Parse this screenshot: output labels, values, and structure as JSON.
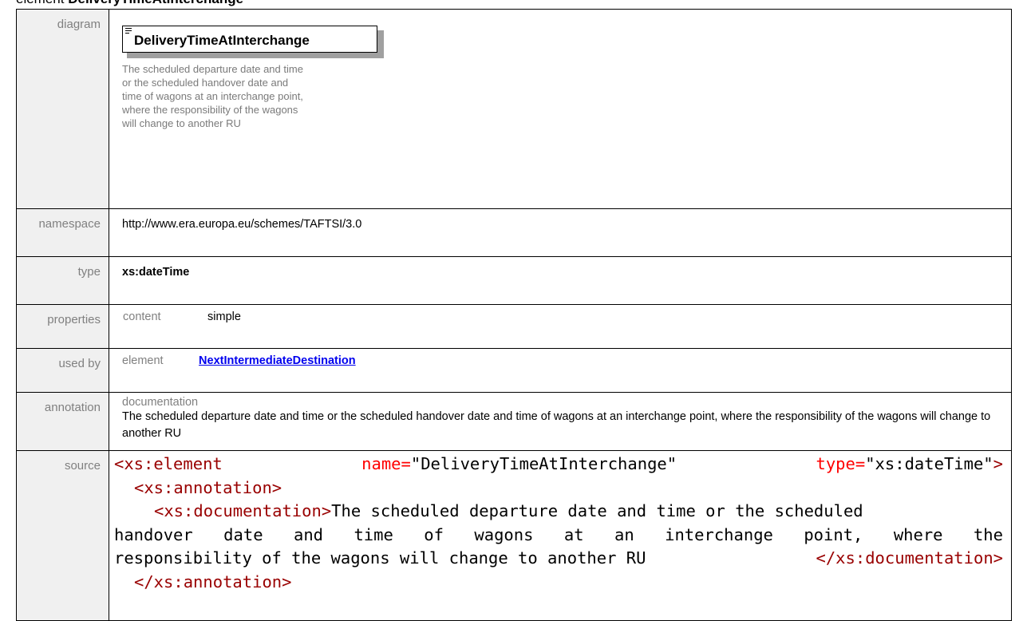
{
  "heading": {
    "prefix": "element",
    "name": "DeliveryTimeAtInterchange"
  },
  "rows": {
    "diagram": {
      "label": "diagram",
      "box_title": "DeliveryTimeAtInterchange",
      "doc": "The scheduled departure date and time or the scheduled handover date and time of wagons at an interchange point, where the responsibility of the wagons will change to another RU"
    },
    "namespace": {
      "label": "namespace",
      "value": "http://www.era.europa.eu/schemes/TAFTSI/3.0"
    },
    "type": {
      "label": "type",
      "value": "xs:dateTime"
    },
    "properties": {
      "label": "properties",
      "key": "content",
      "value": "simple"
    },
    "used_by": {
      "label": "used by",
      "key": "element",
      "link": "NextIntermediateDestination"
    },
    "annotation": {
      "label": "annotation",
      "head": "documentation",
      "text": "The scheduled departure date and time or the scheduled handover date and time of wagons at an interchange point, where the responsibility of the wagons will change to another RU"
    },
    "source": {
      "label": "source",
      "l1_tag": "<xs:element",
      "l1_attr1": "name=",
      "l1_val1": "\"DeliveryTimeAtInterchange\"",
      "l1_attr2": "type=",
      "l1_val2": "\"xs:dateTime\"",
      "l1_close": ">",
      "l2_tag": "<xs:annotation>",
      "l3_tag": "<xs:documentation>",
      "l3_text": "The scheduled departure date and time or the scheduled",
      "l4_text": "handover date and time of wagons at an interchange point, where the",
      "l5_text": "responsibility of the wagons will change to another RU",
      "l5_tag": "</xs:documentation>",
      "l6_tag": "</xs:annotation>"
    }
  }
}
